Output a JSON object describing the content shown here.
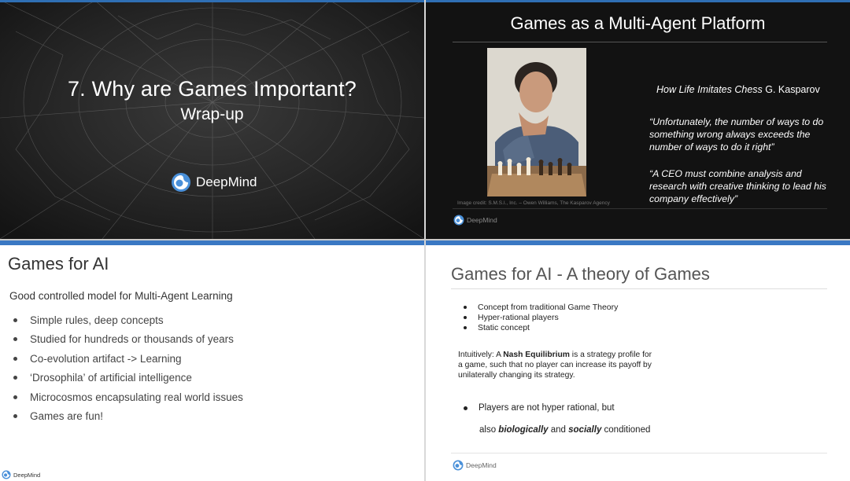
{
  "slide1": {
    "title": "7.  Why are Games Important?",
    "subtitle": "Wrap-up",
    "brand": "DeepMind"
  },
  "slide2": {
    "title": "Games as a Multi-Agent Platform",
    "book_title": "How Life Imitates Chess",
    "book_author": "G. Kasparov",
    "quote1": "“Unfortunately, the number of ways to do something wrong always exceeds the number of ways to do it right”",
    "quote2": "“A CEO must combine analysis and research with creative thinking to lead his company effectively”",
    "credit": "Image credit: S.M.S.I., Inc. – Owen Williams, The Kasparov Agency",
    "brand": "DeepMind"
  },
  "slide3": {
    "title": "Games for AI",
    "intro": "Good controlled model  for Multi-Agent Learning",
    "bullets": [
      "Simple rules, deep concepts",
      "Studied for hundreds or thousands of years",
      "Co-evolution artifact -> Learning",
      "‘Drosophila’ of artificial intelligence",
      "Microcosmos encapsulating real world issues",
      "Games are fun!"
    ],
    "brand": "DeepMind"
  },
  "slide4": {
    "title": "Games for AI - A theory of Games",
    "bullets": [
      "Concept from traditional Game Theory",
      "Hyper-rational players",
      "Static concept"
    ],
    "para_prefix": "Intuitively: A ",
    "para_bold": "Nash Equilibrium",
    "para_suffix": " is a strategy profile for a game, such that no player can increase its payoff by unilaterally changing its strategy.",
    "bullet_big": "Players are not hyper rational, but",
    "cont_prefix": "also ",
    "cont_bold1": "biologically",
    "cont_mid": " and ",
    "cont_bold2": "socially",
    "cont_suffix": " conditioned",
    "brand": "DeepMind"
  },
  "colors": {
    "accent_blue": "#3a78c3",
    "logo_blue": "#4a90d9"
  }
}
